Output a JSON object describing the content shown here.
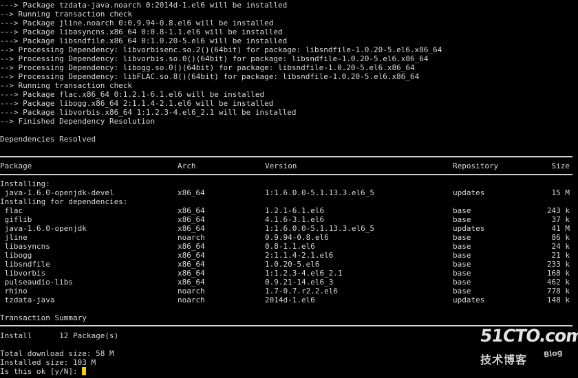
{
  "log_lines": [
    "---> Package tzdata-java.noarch 0:2014d-1.el6 will be installed",
    "--> Running transaction check",
    "---> Package jline.noarch 0:0.9.94-0.8.el6 will be installed",
    "---> Package libasyncns.x86_64 0:0.8-1.1.el6 will be installed",
    "---> Package libsndfile.x86_64 0:1.0.20-5.el6 will be installed",
    "--> Processing Dependency: libvorbisenc.so.2()(64bit) for package: libsndfile-1.0.20-5.el6.x86_64",
    "--> Processing Dependency: libvorbis.so.0()(64bit) for package: libsndfile-1.0.20-5.el6.x86_64",
    "--> Processing Dependency: libogg.so.0()(64bit) for package: libsndfile-1.0.20-5.el6.x86_64",
    "--> Processing Dependency: libFLAC.so.8()(64bit) for package: libsndfile-1.0.20-5.el6.x86_64",
    "--> Running transaction check",
    "---> Package flac.x86_64 0:1.2.1-6.1.el6 will be installed",
    "---> Package libogg.x86_64 2:1.1.4-2.1.el6 will be installed",
    "---> Package libvorbis.x86_64 1:1.2.3-4.el6_2.1 will be installed",
    "--> Finished Dependency Resolution"
  ],
  "resolved_label": "Dependencies Resolved",
  "table": {
    "headers": {
      "package": "Package",
      "arch": "Arch",
      "version": "Version",
      "repository": "Repository",
      "size": "Size"
    },
    "installing_label": "Installing:",
    "installing_rows": [
      {
        "package": " java-1.6.0-openjdk-devel",
        "arch": "x86_64",
        "version": "1:1.6.0.0-5.1.13.3.el6_5",
        "repository": "updates",
        "size": "15 M"
      }
    ],
    "deps_label": "Installing for dependencies:",
    "dep_rows": [
      {
        "package": " flac",
        "arch": "x86_64",
        "version": "1.2.1-6.1.el6",
        "repository": "base",
        "size": "243 k"
      },
      {
        "package": " giflib",
        "arch": "x86_64",
        "version": "4.1.6-3.1.el6",
        "repository": "base",
        "size": "37 k"
      },
      {
        "package": " java-1.6.0-openjdk",
        "arch": "x86_64",
        "version": "1:1.6.0.0-5.1.13.3.el6_5",
        "repository": "updates",
        "size": "41 M"
      },
      {
        "package": " jline",
        "arch": "noarch",
        "version": "0.9.94-0.8.el6",
        "repository": "base",
        "size": "86 k"
      },
      {
        "package": " libasyncns",
        "arch": "x86_64",
        "version": "0.8-1.1.el6",
        "repository": "base",
        "size": "24 k"
      },
      {
        "package": " libogg",
        "arch": "x86_64",
        "version": "2:1.1.4-2.1.el6",
        "repository": "base",
        "size": "21 k"
      },
      {
        "package": " libsndfile",
        "arch": "x86_64",
        "version": "1.0.20-5.el6",
        "repository": "base",
        "size": "233 k"
      },
      {
        "package": " libvorbis",
        "arch": "x86_64",
        "version": "1:1.2.3-4.el6_2.1",
        "repository": "base",
        "size": "168 k"
      },
      {
        "package": " pulseaudio-libs",
        "arch": "x86_64",
        "version": "0.9.21-14.el6_3",
        "repository": "base",
        "size": "462 k"
      },
      {
        "package": " rhino",
        "arch": "noarch",
        "version": "1.7-0.7.r2.2.el6",
        "repository": "base",
        "size": "778 k"
      },
      {
        "package": " tzdata-java",
        "arch": "noarch",
        "version": "2014d-1.el6",
        "repository": "updates",
        "size": "148 k"
      }
    ]
  },
  "summary": {
    "title": "Transaction Summary",
    "install_line": "Install      12 Package(s)",
    "download_size": "Total download size: 58 M",
    "installed_size": "Installed size: 103 M",
    "prompt": "Is this ok [y/N]: "
  },
  "watermark": {
    "domain": "51CTO.com",
    "subtitle": "技术博客",
    "blog": "Blog"
  },
  "colors": {
    "background": "#000000",
    "text": "#d8d8d8",
    "cursor": "#f0d000"
  }
}
